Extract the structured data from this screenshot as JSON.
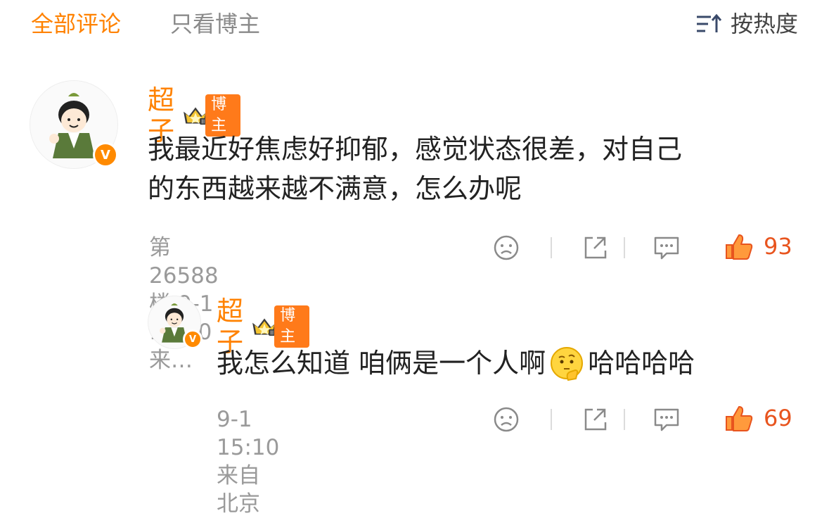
{
  "tabs": {
    "all": "全部评论",
    "blogger_only": "只看博主"
  },
  "sort": {
    "label": "按热度"
  },
  "comments": [
    {
      "user": "超子",
      "badge": "博主",
      "text_line1": "我最近好焦虑好抑郁，感觉状态很差，对自己",
      "text_line2": "的东西越来越不满意，怎么办呢",
      "meta": "第26588楼  9-1 15:10  来…",
      "likes": "93"
    },
    {
      "user": "超子",
      "badge": "博主",
      "text_before": "我怎么知道 咱俩是一个人啊",
      "text_after": "哈哈哈哈",
      "meta": "9-1 15:10  来自 北京",
      "likes": "69"
    }
  ],
  "colors": {
    "accent": "#ff8200",
    "like": "#e8541e",
    "meta": "#9a9a9a"
  },
  "icons": [
    "sort-icon",
    "sad-face-icon",
    "share-icon",
    "comment-icon",
    "thumbs-up-icon",
    "crown-icon",
    "verified-icon",
    "thinking-emoji"
  ]
}
